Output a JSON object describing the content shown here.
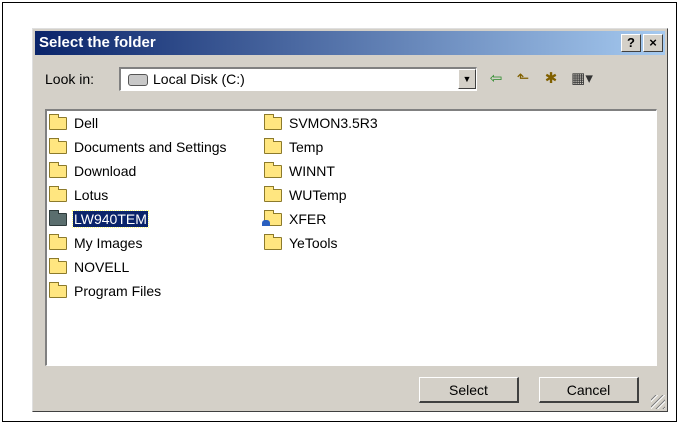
{
  "dialog": {
    "title": "Select the folder",
    "help_glyph": "?",
    "close_glyph": "×"
  },
  "lookin": {
    "label": "Look in:",
    "value": "Local Disk (C:)"
  },
  "toolbar": {
    "back_glyph": "⇦",
    "up_glyph": "⬑",
    "new_folder_glyph": "✱",
    "views_glyph": "▦▾",
    "dropdown_glyph": "▼"
  },
  "folders_col1": [
    "Dell",
    "Documents and Settings",
    "Download",
    "Lotus",
    "LW940TEM",
    "My Images",
    "NOVELL",
    "Program Files"
  ],
  "folders_col2": [
    "SVMON3.5R3",
    "Temp",
    "WINNT",
    "WUTemp",
    "XFER",
    "YeTools"
  ],
  "selected_folder": "LW940TEM",
  "buttons": {
    "select": "Select",
    "cancel": "Cancel"
  },
  "colors": {
    "titlebar_start": "#0a246a",
    "titlebar_end": "#a6caf0",
    "face": "#d4d0c8",
    "selection": "#0a246a"
  }
}
